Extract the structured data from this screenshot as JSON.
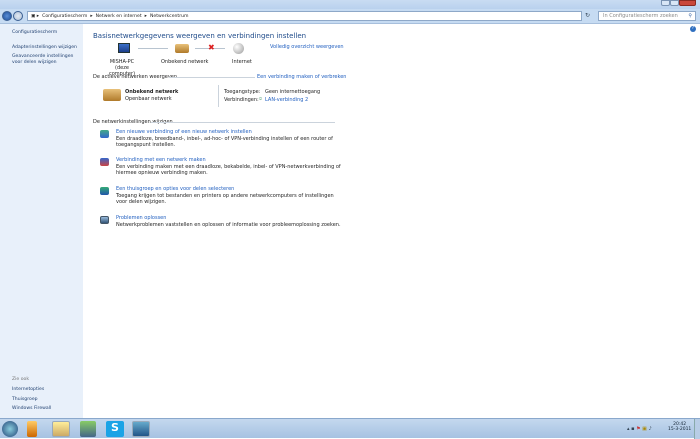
{
  "breadcrumb": [
    "Configuratiescherm",
    "Netwerk en internet",
    "Netwerkcentrum"
  ],
  "search_placeholder": "In Configuratiescherm zoeken",
  "sidebar": {
    "items": [
      "Configuratiescherm",
      "Adapterinstellingen wijzigen",
      "Geavanceerde instellingen voor delen wijzigen"
    ],
    "see_also_title": "Zie ook",
    "see_also": [
      "Internetopties",
      "Thuisgroep",
      "Windows Firewall"
    ]
  },
  "main": {
    "title": "Basisnetwerkgegevens weergeven en verbindingen instellen",
    "full_map_link": "Volledig overzicht weergeven",
    "map": {
      "pc": "MISHA-PC",
      "pc_sub": "(deze computer)",
      "network": "Onbekend netwerk",
      "internet": "Internet"
    },
    "active_header": "De actieve netwerken weergeven",
    "connect_link": "Een verbinding maken of verbreken",
    "active": {
      "name": "Onbekend netwerk",
      "type": "Openbaar netwerk",
      "access_label": "Toegangstype:",
      "access_value": "Geen internettoegang",
      "conn_label": "Verbindingen:",
      "conn_value": "LAN-verbinding 2"
    },
    "change_header": "De netwerkinstellingen wijzigen",
    "tasks": [
      {
        "title": "Een nieuwe verbinding of een nieuw netwerk instellen",
        "desc": "Een draadloze, breedband-, inbel-, ad-hoc- of VPN-verbinding instellen of een router of toegangspunt instellen."
      },
      {
        "title": "Verbinding met een netwerk maken",
        "desc": "Een verbinding maken met een draadloze, bekabelde, inbel- of VPN-netwerkverbinding of hiermee opnieuw verbinding maken."
      },
      {
        "title": "Een thuisgroep en opties voor delen selecteren",
        "desc": "Toegang krijgen tot bestanden en printers op andere netwerkcomputers of instellingen voor delen wijzigen."
      },
      {
        "title": "Problemen oplossen",
        "desc": "Netwerkproblemen vaststellen en oplossen of informatie voor probleemoplossing zoeken."
      }
    ]
  },
  "clock": {
    "time": "20:42",
    "date": "15-3-2011"
  }
}
